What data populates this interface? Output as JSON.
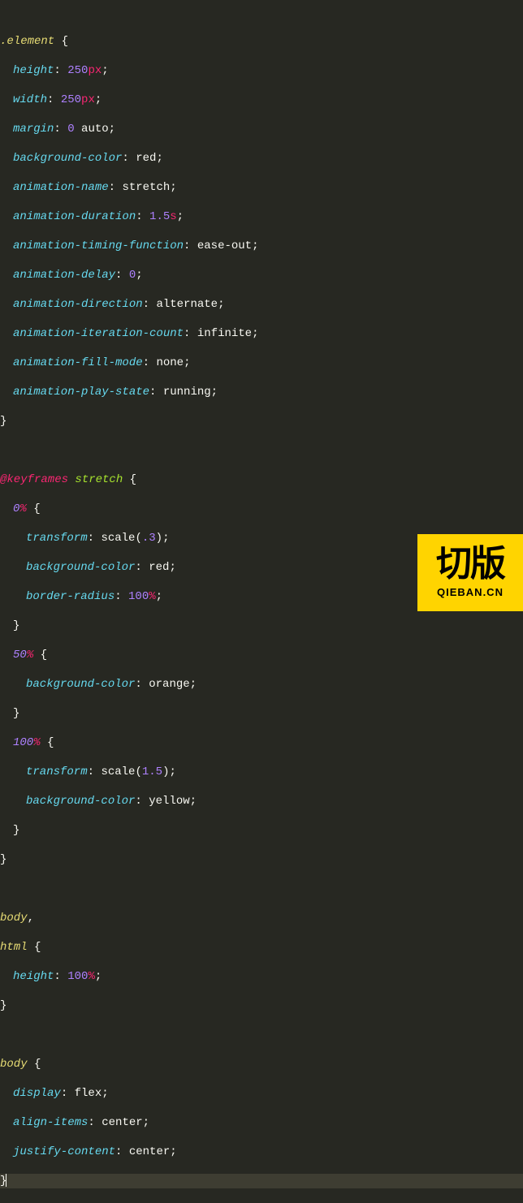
{
  "code": {
    "selector1": ".element",
    "props1": [
      {
        "name": "height",
        "value": "250",
        "unit": "px"
      },
      {
        "name": "width",
        "value": "250",
        "unit": "px"
      },
      {
        "name": "margin",
        "value_parts": [
          {
            "num": "0"
          },
          {
            "lit": " auto"
          }
        ]
      },
      {
        "name": "background-color",
        "value_lit": "red"
      },
      {
        "name": "animation-name",
        "value_lit": "stretch"
      },
      {
        "name": "animation-duration",
        "value": "1.5",
        "unit": "s"
      },
      {
        "name": "animation-timing-function",
        "value_lit": "ease-out"
      },
      {
        "name": "animation-delay",
        "value": "0"
      },
      {
        "name": "animation-direction",
        "value_lit": "alternate"
      },
      {
        "name": "animation-iteration-count",
        "value_lit": "infinite"
      },
      {
        "name": "animation-fill-mode",
        "value_lit": "none"
      },
      {
        "name": "animation-play-state",
        "value_lit": "running"
      }
    ],
    "atrule": "@keyframes",
    "kfname": "stretch",
    "kf0_pct": "0",
    "kf0": [
      {
        "name": "transform",
        "fn": "scale",
        "arg": ".3"
      },
      {
        "name": "background-color",
        "value_lit": "red"
      },
      {
        "name": "border-radius",
        "value": "100",
        "unit": "%"
      }
    ],
    "kf50_pct": "50",
    "kf50": [
      {
        "name": "background-color",
        "value_lit": "orange"
      }
    ],
    "kf100_pct": "100",
    "kf100": [
      {
        "name": "transform",
        "fn": "scale",
        "arg": "1.5"
      },
      {
        "name": "background-color",
        "value_lit": "yellow"
      }
    ],
    "sel_body": "body",
    "sel_html": "html",
    "props_bh": [
      {
        "name": "height",
        "value": "100",
        "unit": "%"
      }
    ],
    "sel_body2": "body",
    "props_body2": [
      {
        "name": "display",
        "value_lit": "flex"
      },
      {
        "name": "align-items",
        "value_lit": "center"
      },
      {
        "name": "justify-content",
        "value_lit": "center"
      }
    ]
  },
  "watermark": {
    "main": "切版",
    "sub": "QIEBAN.CN"
  }
}
